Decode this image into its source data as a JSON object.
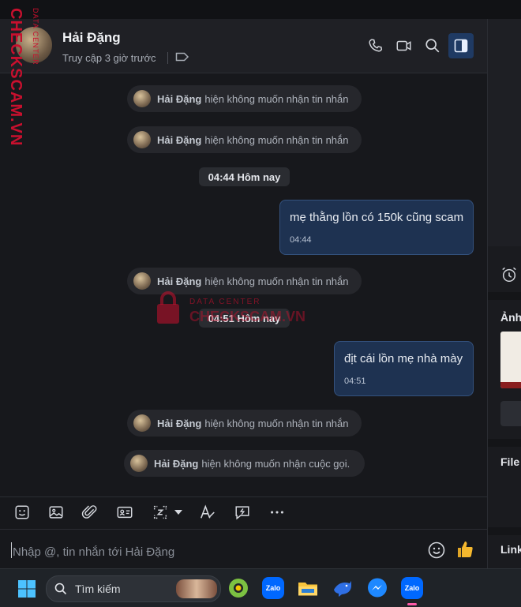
{
  "header": {
    "name": "Hải Đặng",
    "status": "Truy cập 3 giờ trước"
  },
  "messages": {
    "system_name": "Hải Đặng",
    "system_text": "hiện không muốn nhận tin nhắn",
    "call_text": "hiện không muốn nhận cuộc gọi.",
    "time1": "04:44 Hôm nay",
    "bubble1_text": "mẹ thằng lồn có 150k cũng scam",
    "bubble1_time": "04:44",
    "time2": "04:51 Hôm nay",
    "bubble2_text": "địt cái lồn mẹ nhà mày",
    "bubble2_time": "04:51"
  },
  "input": {
    "placeholder": "Nhập @, tin nhắn tới Hải Đặng"
  },
  "side": {
    "photos_label": "Ảnh",
    "files_label": "File",
    "links_label": "Link"
  },
  "taskbar": {
    "search_label": "Tìm kiếm"
  },
  "watermark": {
    "vertical": "CHECKSCAM.VN",
    "vertical_small": "DATA CENTER",
    "center_top": "DATA CENTER",
    "center_main": "CHECKSCAM.VN"
  },
  "colors": {
    "accent": "#0068ff",
    "bubble": "#1e3251",
    "watermark": "#c8102e"
  }
}
